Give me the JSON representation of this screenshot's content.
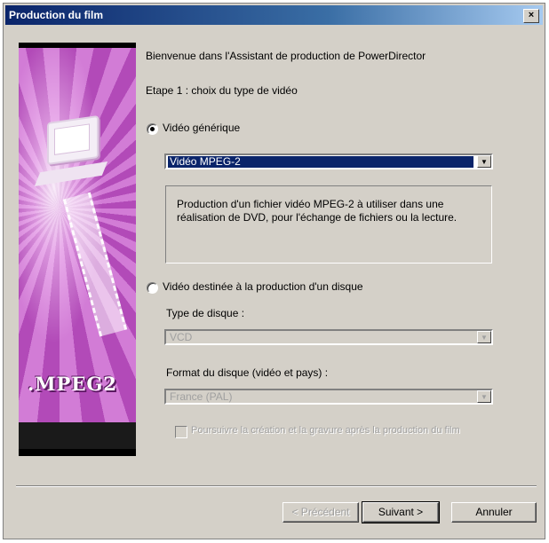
{
  "window": {
    "title": "Production du film",
    "close_label": "×"
  },
  "sidebar": {
    "banner_text": ".MPEG2"
  },
  "intro": {
    "welcome": "Bienvenue dans l'Assistant de production de PowerDirector",
    "step": "Etape 1 : choix du type de vidéo"
  },
  "option_generic": {
    "label": "Vidéo générique",
    "selected": true,
    "format_value": "Vidéo MPEG-2",
    "description": "Production d'un fichier vidéo MPEG-2 à utiliser dans une réalisation de DVD, pour l'échange de fichiers ou la lecture."
  },
  "option_disc": {
    "label": "Vidéo destinée à la production d'un disque",
    "selected": false,
    "disc_type_label": "Type de disque :",
    "disc_type_value": "VCD",
    "disc_format_label": "Format du disque (vidéo et pays) :",
    "disc_format_value": "France (PAL)",
    "burn_checkbox_label": "Poursuivre la création et la gravure après la production du film"
  },
  "buttons": {
    "prev_label": "< Précédent",
    "next_label": "Suivant >",
    "cancel_label": "Annuler"
  },
  "colors": {
    "titlebar": "#0a246a",
    "sidebar_accent": "#b24ab8",
    "selection": "#0a246a"
  }
}
